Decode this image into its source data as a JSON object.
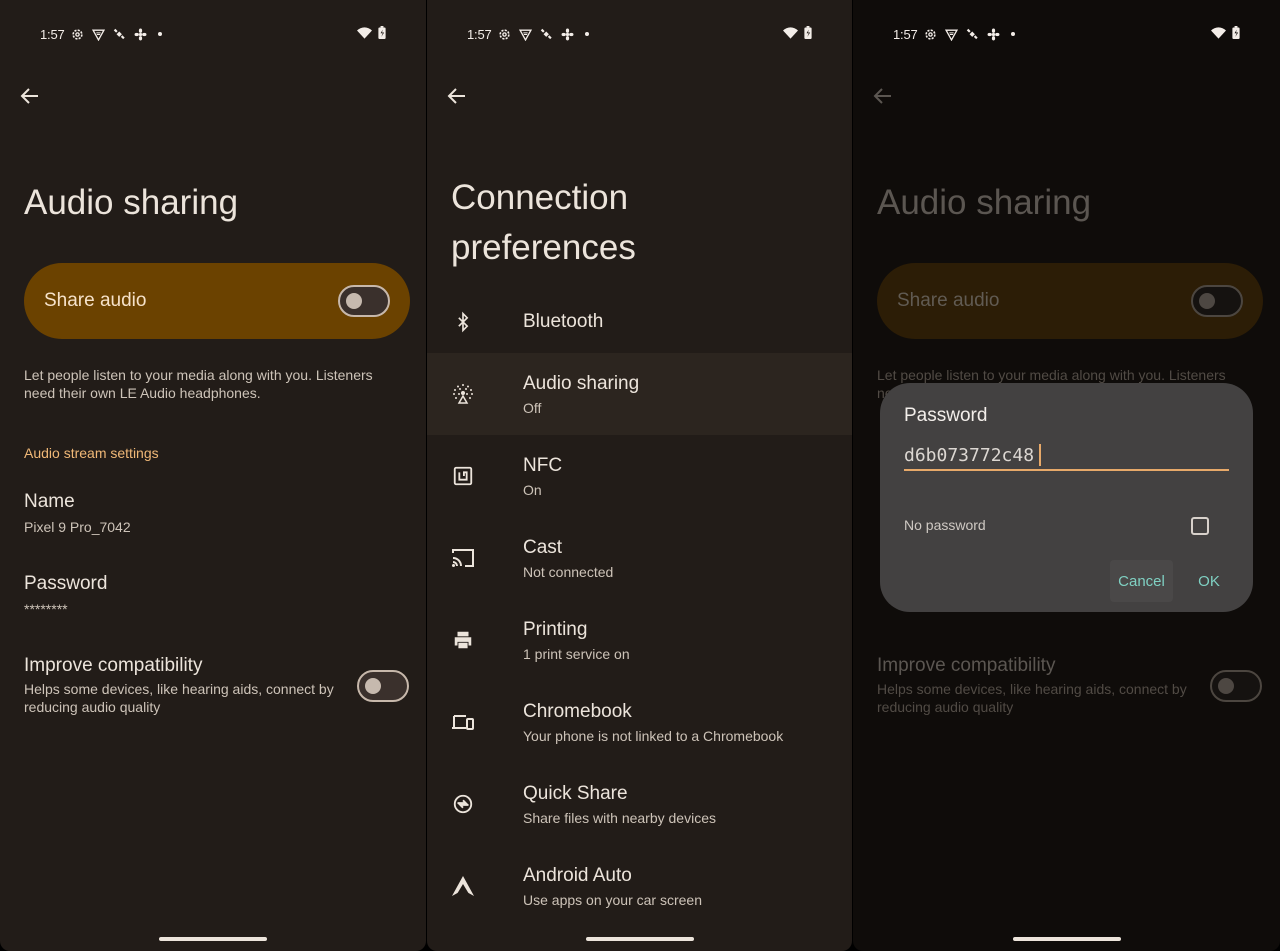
{
  "status_bar": {
    "time": "1:57",
    "left_icons": [
      "settings-icon",
      "vpn-shield-icon",
      "satellite-icon",
      "fan-icon",
      "notification-dot-icon"
    ],
    "right_icons": [
      "wifi-icon",
      "battery-charging-icon"
    ]
  },
  "panel_audio_sharing": {
    "title": "Audio sharing",
    "share_audio": {
      "label": "Share audio",
      "enabled": false
    },
    "description": "Let people listen to your media along with you. Listeners need their own LE Audio headphones.",
    "section_header": "Audio stream settings",
    "name": {
      "title": "Name",
      "value": "Pixel 9 Pro_7042"
    },
    "password": {
      "title": "Password",
      "value": "********"
    },
    "improve_compatibility": {
      "title": "Improve compatibility",
      "summary": "Helps some devices, like hearing aids, connect by reducing audio quality",
      "enabled": false
    }
  },
  "panel_connection_preferences": {
    "title_line1": "Connection",
    "title_line2": "preferences",
    "items": [
      {
        "icon": "bluetooth-icon",
        "title": "Bluetooth",
        "summary": ""
      },
      {
        "icon": "audio-sharing-icon",
        "title": "Audio sharing",
        "summary": "Off",
        "highlighted": true
      },
      {
        "icon": "nfc-icon",
        "title": "NFC",
        "summary": "On"
      },
      {
        "icon": "cast-icon",
        "title": "Cast",
        "summary": "Not connected"
      },
      {
        "icon": "printer-icon",
        "title": "Printing",
        "summary": "1 print service on"
      },
      {
        "icon": "chromebook-icon",
        "title": "Chromebook",
        "summary": "Your phone is not linked to a Chromebook"
      },
      {
        "icon": "quick-share-icon",
        "title": "Quick Share",
        "summary": "Share files with nearby devices"
      },
      {
        "icon": "android-auto-icon",
        "title": "Android Auto",
        "summary": "Use apps on your car screen"
      }
    ]
  },
  "password_dialog": {
    "title": "Password",
    "input_value": "d6b073772c48",
    "no_password_label": "No password",
    "no_password_checked": false,
    "cancel_label": "Cancel",
    "ok_label": "OK"
  },
  "colors": {
    "background": "#221c18",
    "share_card": "#6b4200",
    "section_accent": "#f0b877",
    "dialog_accent": "#e7a969",
    "dialog_button": "#7fd0c2"
  }
}
